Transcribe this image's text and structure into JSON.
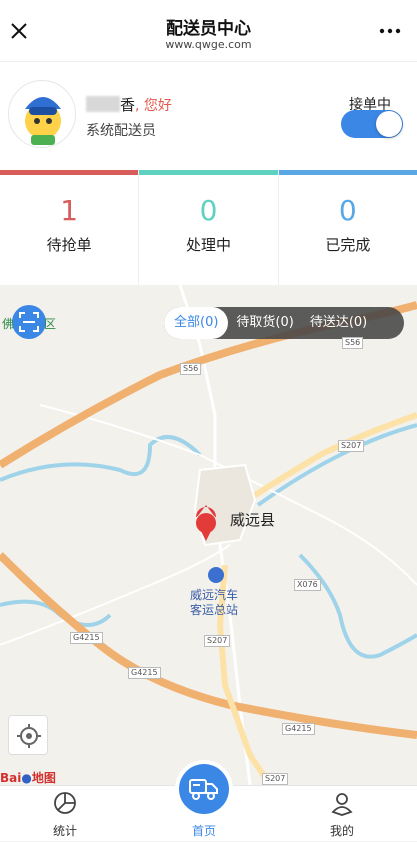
{
  "header": {
    "title": "配送员中心",
    "url": "www.qwge.com"
  },
  "profile": {
    "name_visible": "香",
    "greeting": ", 您好",
    "role": "系统配送员",
    "toggle_label": "接单中",
    "toggle_on": true
  },
  "stats": [
    {
      "count": "1",
      "label": "待抢单",
      "color": "#d85c5a"
    },
    {
      "count": "0",
      "label": "处理中",
      "color": "#5fd1c0"
    },
    {
      "count": "0",
      "label": "已完成",
      "color": "#5aa7e6"
    }
  ],
  "filters": [
    {
      "label": "全部(0)",
      "active": true
    },
    {
      "label": "待取货(0)",
      "active": false
    },
    {
      "label": "待送达(0)",
      "active": false
    }
  ],
  "map": {
    "city": "威远县",
    "station": "威远汽车\n客运总站",
    "edge_label_left": "佛",
    "edge_label_right": "区",
    "roads": [
      "S56",
      "S56",
      "S207",
      "S207",
      "S207",
      "X076",
      "G4215",
      "G4215",
      "G4215"
    ],
    "logo_a": "Bai",
    "logo_b": "地图"
  },
  "tabs": [
    {
      "label": "统计",
      "icon": "pie-chart-icon"
    },
    {
      "label": "首页",
      "icon": "delivery-truck-icon"
    },
    {
      "label": "我的",
      "icon": "user-icon"
    }
  ],
  "colors": {
    "accent": "#3b87e6",
    "map_bg": "#f3f1ec",
    "road_main": "#f0b070",
    "river": "#9fd3ea"
  }
}
